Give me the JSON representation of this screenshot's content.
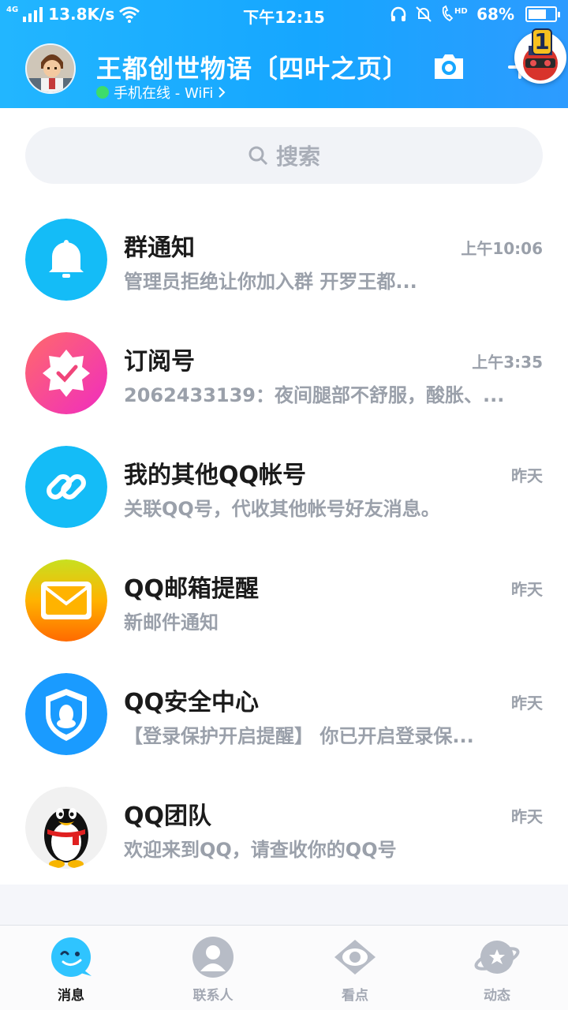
{
  "status_bar": {
    "network": "4G",
    "speed": "13.8K/s",
    "time": "下午12:15",
    "battery": "68%",
    "battery_level": 0.68,
    "hd": "HD"
  },
  "header": {
    "title": "王都创世物语〔四叶之页〕",
    "online_status": "手机在线 - WiFi",
    "badge_count": "1",
    "accent_color": "#1aa6ff"
  },
  "search": {
    "placeholder": "搜索"
  },
  "conversations": [
    {
      "name": "群通知",
      "time": "上午10:06",
      "preview": "管理员拒绝让你加入群 开罗王都...",
      "icon": "bell-icon"
    },
    {
      "name": "订阅号",
      "time": "上午3:35",
      "preview": "2062433139：夜间腿部不舒服，酸胀、...",
      "icon": "subscription-badge-icon"
    },
    {
      "name": "我的其他QQ帐号",
      "time": "昨天",
      "preview": "关联QQ号，代收其他帐号好友消息。",
      "icon": "link-icon"
    },
    {
      "name": "QQ邮箱提醒",
      "time": "昨天",
      "preview": "新邮件通知",
      "icon": "mail-icon"
    },
    {
      "name": "QQ安全中心",
      "time": "昨天",
      "preview": "【登录保护开启提醒】 你已开启登录保...",
      "icon": "shield-icon"
    },
    {
      "name": "QQ团队",
      "time": "昨天",
      "preview": "欢迎来到QQ，请查收你的QQ号",
      "icon": "penguin-icon"
    }
  ],
  "nav": [
    {
      "label": "消息",
      "active": true,
      "icon": "message-icon"
    },
    {
      "label": "联系人",
      "active": false,
      "icon": "contacts-icon"
    },
    {
      "label": "看点",
      "active": false,
      "icon": "eye-icon"
    },
    {
      "label": "动态",
      "active": false,
      "icon": "planet-icon"
    }
  ]
}
